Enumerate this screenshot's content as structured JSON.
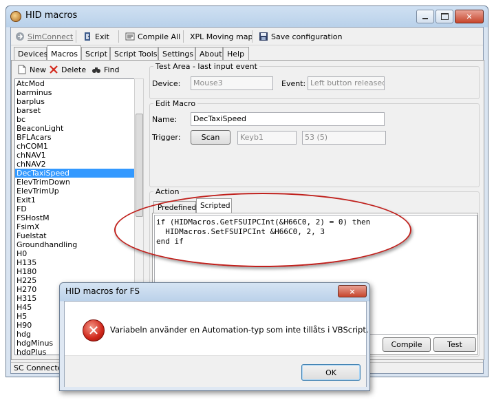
{
  "window": {
    "title": "HID macros"
  },
  "toolbar": {
    "simconnect": "SimConnect",
    "exit": "Exit",
    "compile_all": "Compile All",
    "xpl_moving_map": "XPL Moving map",
    "save_configuration": "Save configuration"
  },
  "tabs": [
    "Devices",
    "Macros",
    "Script",
    "Script Tools",
    "Settings",
    "About",
    "Help"
  ],
  "list_toolbar": {
    "new": "New",
    "delete": "Delete",
    "find": "Find"
  },
  "macros": [
    "AtcMod",
    "barminus",
    "barplus",
    "barset",
    "bc",
    "BeaconLight",
    "BFLAcars",
    "chCOM1",
    "chNAV1",
    "chNAV2",
    "DecTaxiSpeed",
    "ElevTrimDown",
    "ElevTrimUp",
    "Exit1",
    "FD",
    "FSHostM",
    "FsimX",
    "Fuelstat",
    "Groundhandling",
    "H0",
    "H135",
    "H180",
    "H225",
    "H270",
    "H315",
    "H45",
    "H5",
    "H90",
    "hdg",
    "hdgMinus",
    "hdgPlus"
  ],
  "selected_macro": "DecTaxiSpeed",
  "test_area": {
    "label": "Test Area - last input event",
    "device_label": "Device:",
    "device_value": "Mouse3",
    "event_label": "Event:",
    "event_value": "Left button released"
  },
  "edit_macro": {
    "label": "Edit Macro",
    "name_label": "Name:",
    "name_value": "DecTaxiSpeed",
    "trigger_label": "Trigger:",
    "scan_button": "Scan",
    "trigger_key": "Keyb1",
    "trigger_code": "53  (5)"
  },
  "action": {
    "label": "Action",
    "tab_predefined": "Predefined",
    "tab_scripted": "Scripted",
    "code": "if (HIDMacros.GetFSUIPCInt(&H66C0, 2) = 0) then\n  HIDMacros.SetFSUIPCInt &H66C0, 2, 3\nend if",
    "compile_button": "Compile",
    "test_button": "Test"
  },
  "status": {
    "text": "SC Connecte"
  },
  "dialog": {
    "title": "HID macros for FS",
    "message": "Variabeln använder en Automation-typ som inte tillåts i VBScript.",
    "ok_button": "OK",
    "close_icon": "×"
  },
  "colors": {
    "selection": "#3399ff",
    "highlight": "#c0201c"
  }
}
